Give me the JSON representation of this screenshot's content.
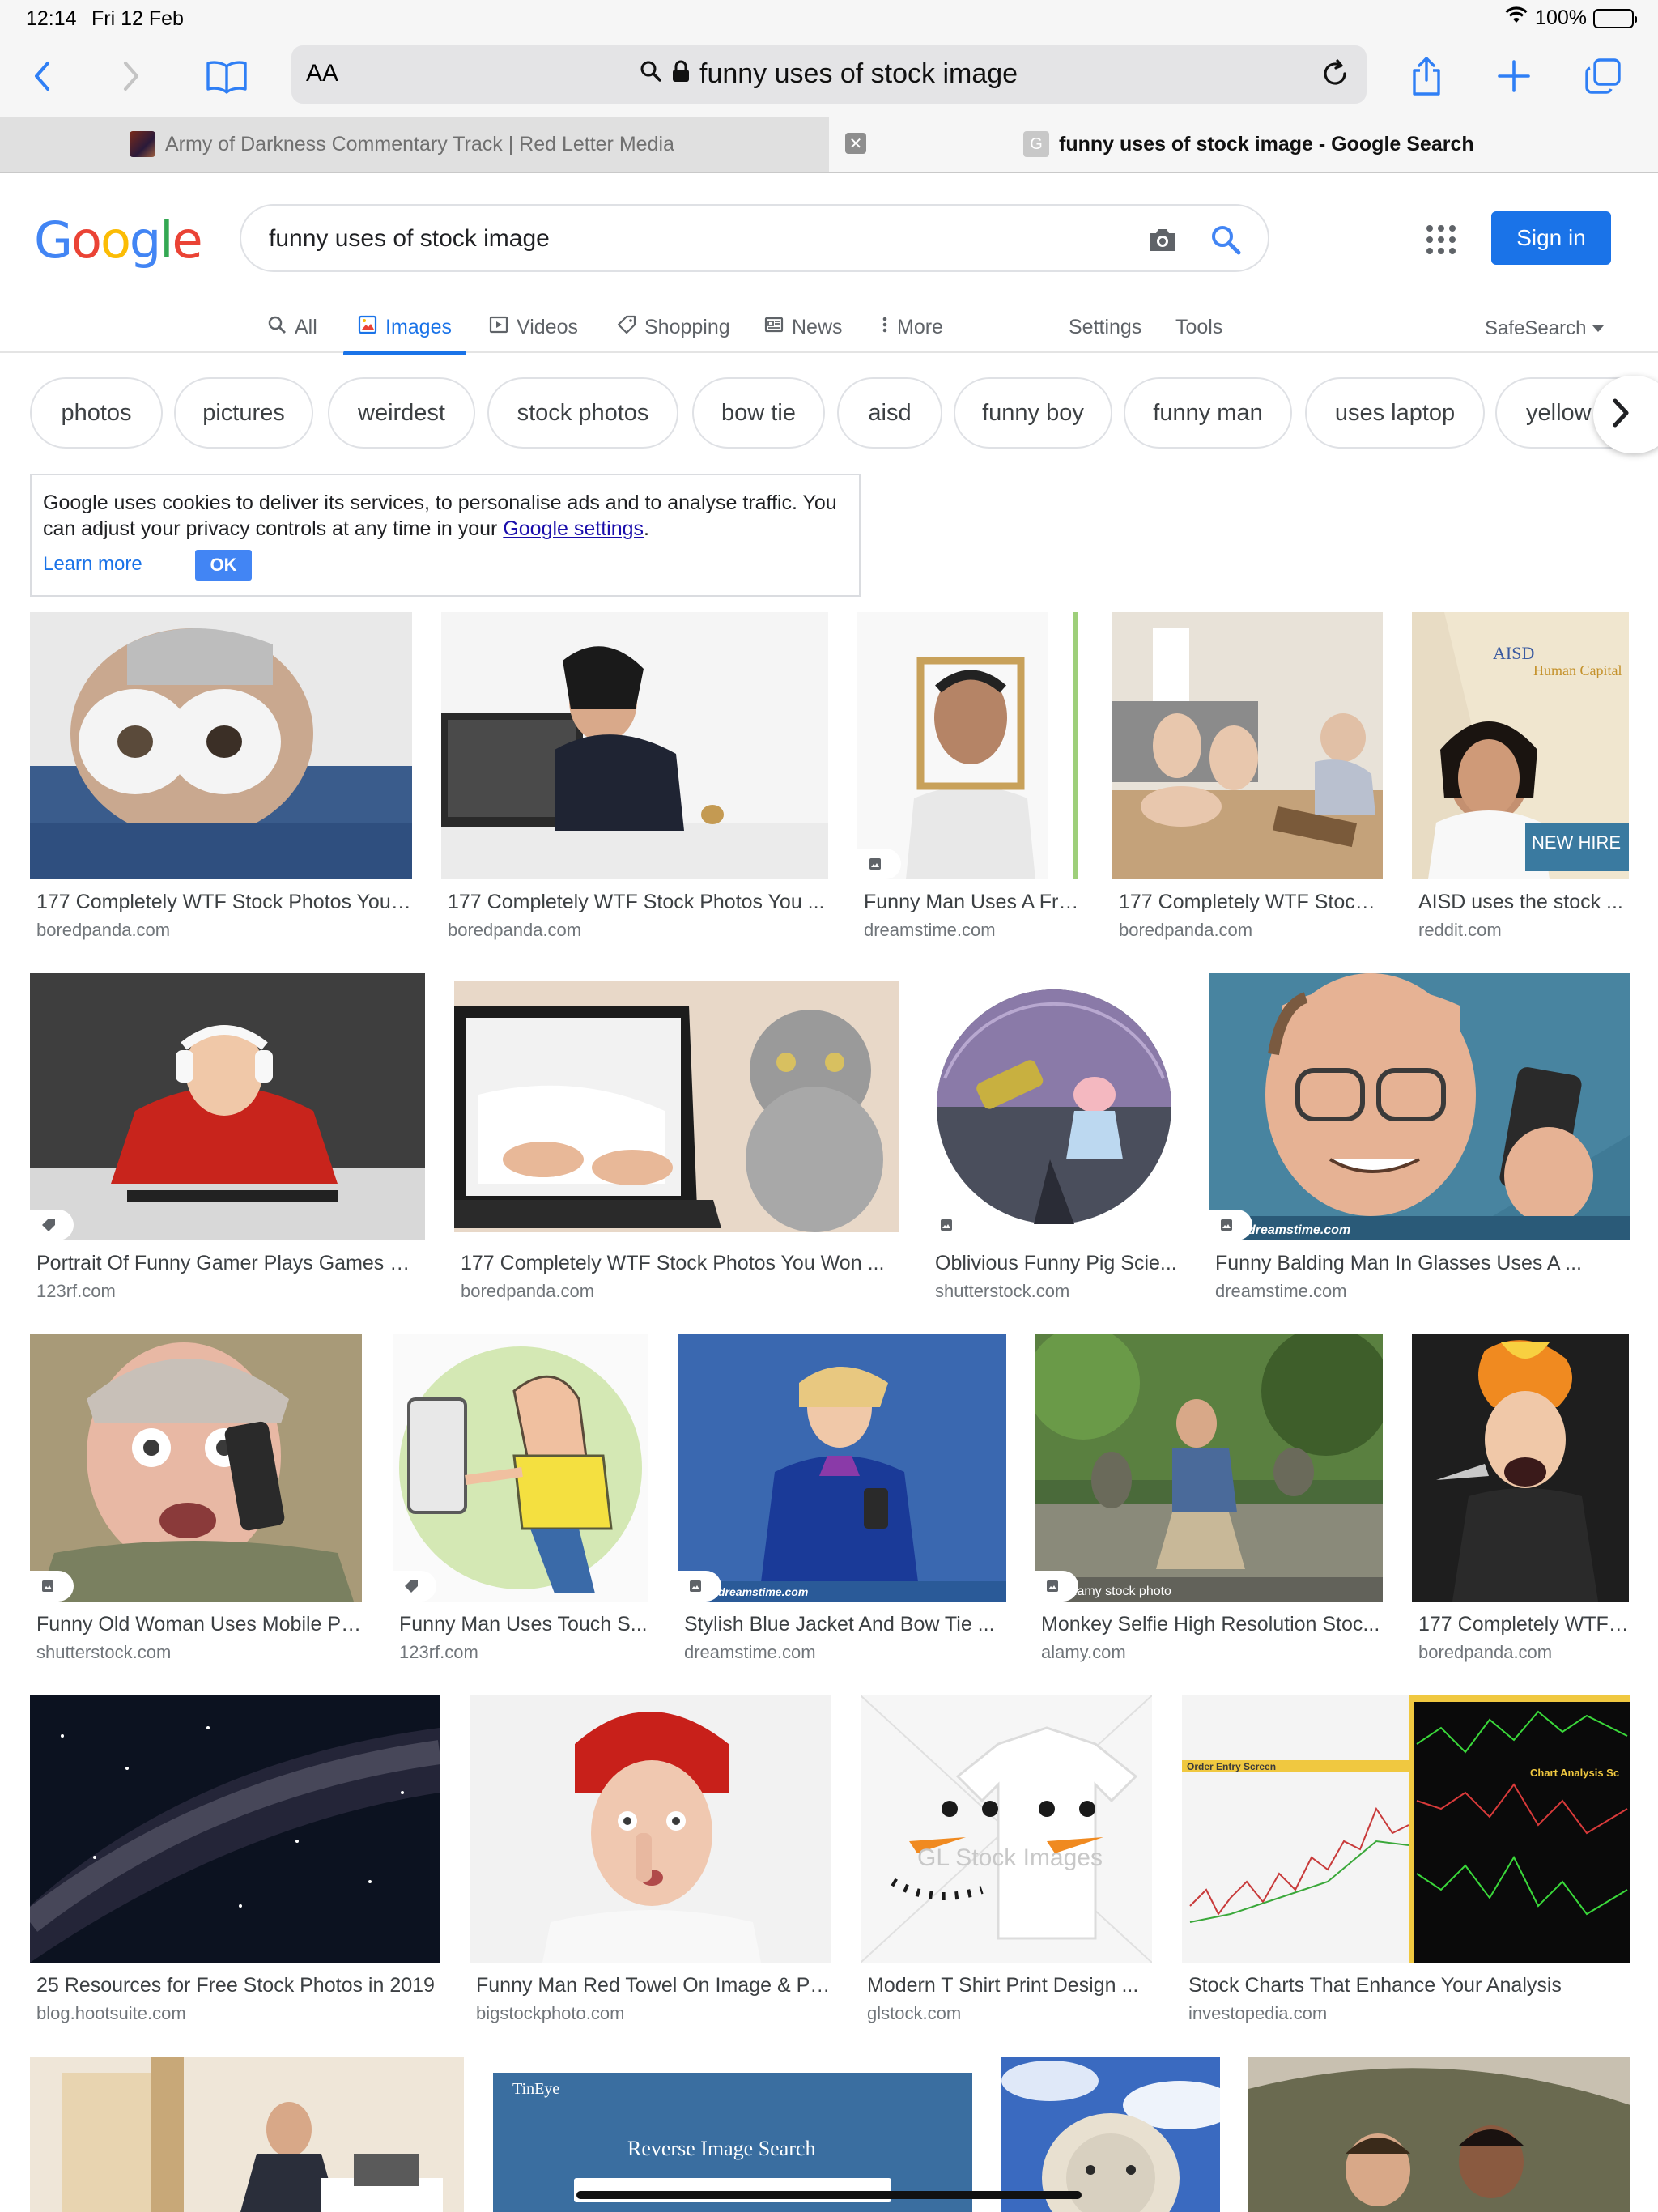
{
  "status": {
    "time": "12:14",
    "date": "Fri 12 Feb",
    "battery": "100%",
    "battery_level": 1.0
  },
  "browser": {
    "reader_label": "AA",
    "url_text": "funny uses of stock image",
    "tabs": [
      {
        "label": "Army of Darkness Commentary Track | Red Letter Media",
        "active": false
      },
      {
        "label": "funny uses of stock image - Google Search",
        "active": true
      }
    ],
    "icons": [
      "back-icon",
      "forward-icon",
      "bookmarks-icon",
      "reader-icon",
      "search-icon",
      "lock-icon",
      "reload-icon",
      "share-icon",
      "new-tab-icon",
      "tabs-icon"
    ]
  },
  "google": {
    "logo": "Google",
    "query": "funny uses of stock image",
    "sign_in": "Sign in",
    "tabs": [
      "All",
      "Images",
      "Videos",
      "Shopping",
      "News",
      "More"
    ],
    "settings": "Settings",
    "tools": "Tools",
    "safesearch": "SafeSearch",
    "colors": {
      "blue": "#1a73e8",
      "logo_blue": "#4285f4",
      "logo_red": "#ea4335",
      "logo_yellow": "#fbbc05",
      "logo_green": "#34a853"
    }
  },
  "chips": [
    "photos",
    "pictures",
    "weirdest",
    "stock photos",
    "bow tie",
    "aisd",
    "funny boy",
    "funny man",
    "uses laptop",
    "yellow b"
  ],
  "cookie": {
    "text_before": "Google uses cookies to deliver its services, to personalise ads and to analyse traffic. You can adjust your privacy controls at any time in your ",
    "link": "Google settings",
    "text_after": ".",
    "learn_more": "Learn more",
    "ok": "OK"
  },
  "results": [
    {
      "title": "177 Completely WTF Stock Photos You ...",
      "site": "boredpanda.com"
    },
    {
      "title": "177 Completely WTF Stock Photos You ...",
      "site": "boredpanda.com"
    },
    {
      "title": "Funny Man Uses A Fra...",
      "site": "dreamstime.com"
    },
    {
      "title": "177 Completely WTF Stock ...",
      "site": "boredpanda.com"
    },
    {
      "title": "AISD uses the stock ...",
      "site": "reddit.com"
    },
    {
      "title": "Portrait Of Funny Gamer Plays Games On...",
      "site": "123rf.com"
    },
    {
      "title": "177 Completely WTF Stock Photos You Won ...",
      "site": "boredpanda.com"
    },
    {
      "title": "Oblivious Funny Pig Scie...",
      "site": "shutterstock.com"
    },
    {
      "title": "Funny Balding Man In Glasses Uses A ...",
      "site": "dreamstime.com"
    },
    {
      "title": "Funny Old Woman Uses Mobile Ph...",
      "site": "shutterstock.com"
    },
    {
      "title": "Funny Man Uses Touch S...",
      "site": "123rf.com"
    },
    {
      "title": "Stylish Blue Jacket And Bow Tie ...",
      "site": "dreamstime.com"
    },
    {
      "title": "Monkey Selfie High Resolution Stoc...",
      "site": "alamy.com"
    },
    {
      "title": "177 Completely WTF ...",
      "site": "boredpanda.com"
    },
    {
      "title": "25 Resources for Free Stock Photos in 2019",
      "site": "blog.hootsuite.com"
    },
    {
      "title": "Funny Man Red Towel On Image & Ph...",
      "site": "bigstockphoto.com"
    },
    {
      "title": "Modern T Shirt Print Design ...",
      "site": "glstock.com"
    },
    {
      "title": "Stock Charts That Enhance Your Analysis",
      "site": "investopedia.com"
    },
    {
      "title": "",
      "site": ""
    },
    {
      "title": "",
      "site": ""
    },
    {
      "title": "",
      "site": ""
    },
    {
      "title": "",
      "site": ""
    }
  ],
  "image_text": {
    "aisd_cover_1": "AISD",
    "aisd_cover_2": "Human Capital",
    "aisd_badge": "NEW HIRE",
    "watermark_dreamstime": "dreamstime.com",
    "watermark_alamy": "alamy stock photo",
    "watermark_glstock": "GL Stock Images",
    "chart_label_1": "Order Entry Screen",
    "chart_label_2": "Chart Analysis Sc",
    "tineye_brand": "TinEye",
    "tineye_title": "Reverse Image Search"
  }
}
